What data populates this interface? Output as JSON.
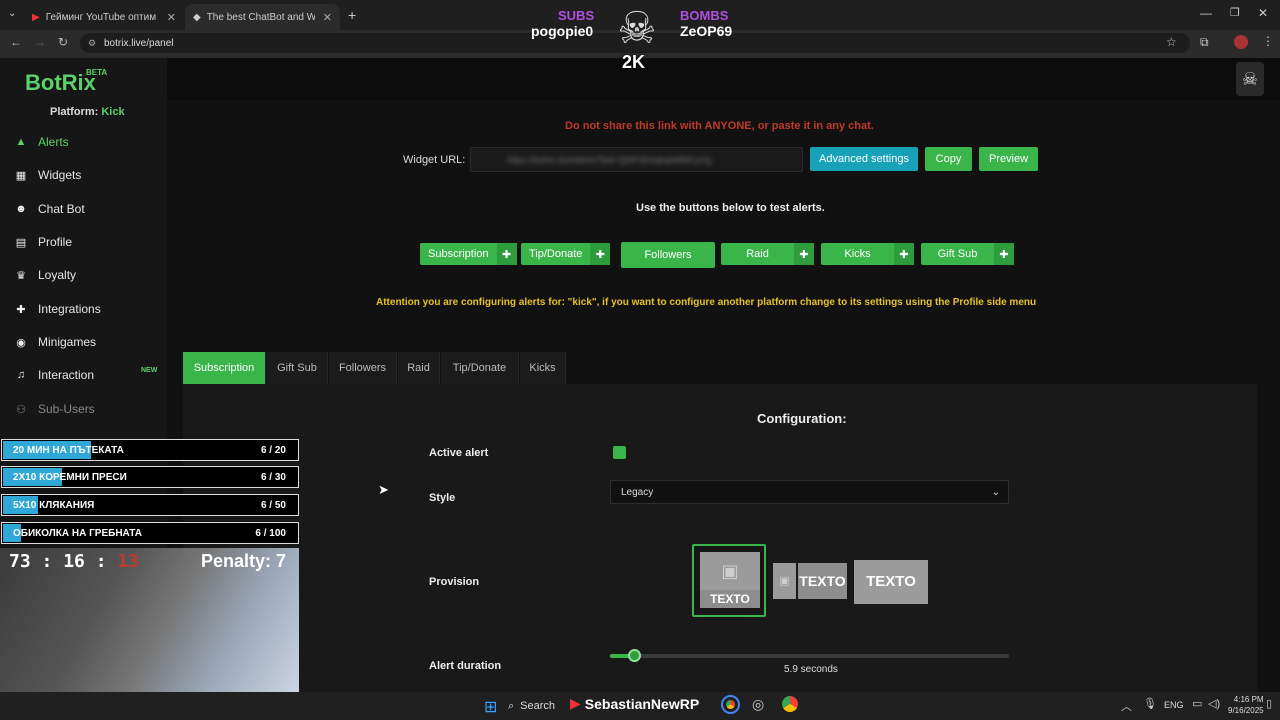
{
  "browser": {
    "tabs": [
      {
        "title": "Гейминг YouTube оптимизаци"
      },
      {
        "title": "The best ChatBot and Widgets"
      }
    ],
    "url": "botrix.live/panel"
  },
  "overlay_top": {
    "subs_label": "SUBS",
    "subs_user": "pogopie0",
    "bombs_label": "BOMBS",
    "bombs_user": "ZeOP69",
    "count": "2K"
  },
  "sidebar": {
    "logo": "BotRix",
    "beta": "BETA",
    "platform_label": "Platform:",
    "platform_value": "Kick",
    "items": [
      {
        "label": "Alerts",
        "icon": "warning-icon"
      },
      {
        "label": "Widgets",
        "icon": "grid-icon"
      },
      {
        "label": "Chat Bot",
        "icon": "robot-icon"
      },
      {
        "label": "Profile",
        "icon": "id-card-icon"
      },
      {
        "label": "Loyalty",
        "icon": "trophy-icon"
      },
      {
        "label": "Integrations",
        "icon": "puzzle-icon"
      },
      {
        "label": "Minigames",
        "icon": "gamepad-icon"
      },
      {
        "label": "Interaction",
        "icon": "music-icon",
        "badge": "NEW"
      },
      {
        "label": "Sub-Users",
        "icon": "users-icon"
      }
    ]
  },
  "main": {
    "warning": "Do not share this link with ANYONE, or paste it in any chat.",
    "widget_url_label": "Widget URL:",
    "widget_url_value": "https://botrix.live/alerts?bid=QbfFWnbjkqbMMGyVg",
    "advanced_settings": "Advanced settings",
    "copy": "Copy",
    "preview": "Preview",
    "test_instruction": "Use the buttons below to test alerts.",
    "test_buttons": [
      "Subscription",
      "Tip/Donate",
      "Followers",
      "Raid",
      "Kicks",
      "Gift Sub"
    ],
    "attention": "Attention you are configuring alerts for: \"kick\", if you want to configure another platform change to its settings using the Profile side menu",
    "tabs": [
      "Subscription",
      "Gift Sub",
      "Followers",
      "Raid",
      "Tip/Donate",
      "Kicks"
    ],
    "config_title": "Configuration:",
    "active_alert": "Active alert",
    "style_label": "Style",
    "style_value": "Legacy",
    "provision_label": "Provision",
    "provision_text": "TEXTO",
    "alert_duration_label": "Alert duration",
    "alert_duration_value": "5.9 seconds",
    "alert_duration_fraction": 0.06
  },
  "stream_overlay": {
    "goals": [
      {
        "label": "20 МИН НА ПЪТЕКАТА",
        "count": "6 / 20",
        "progress": 0.3
      },
      {
        "label": "2X10 КОРЕМНИ ПРЕСИ",
        "count": "6 / 30",
        "progress": 0.2
      },
      {
        "label": "5X10 КЛЯКАНИЯ",
        "count": "6 / 50",
        "progress": 0.12
      },
      {
        "label": "ОБИКОЛКА НА ГРЕБНАТА",
        "count": "6 / 100",
        "progress": 0.06
      }
    ],
    "timer_h": "73",
    "timer_m": "16",
    "timer_s": "13",
    "penalty": "Penalty: 7"
  },
  "taskbar": {
    "search": "Search",
    "channel": "SebastianNewRP",
    "lang": "ENG",
    "time": "4:16 PM",
    "date": "9/16/2025"
  }
}
